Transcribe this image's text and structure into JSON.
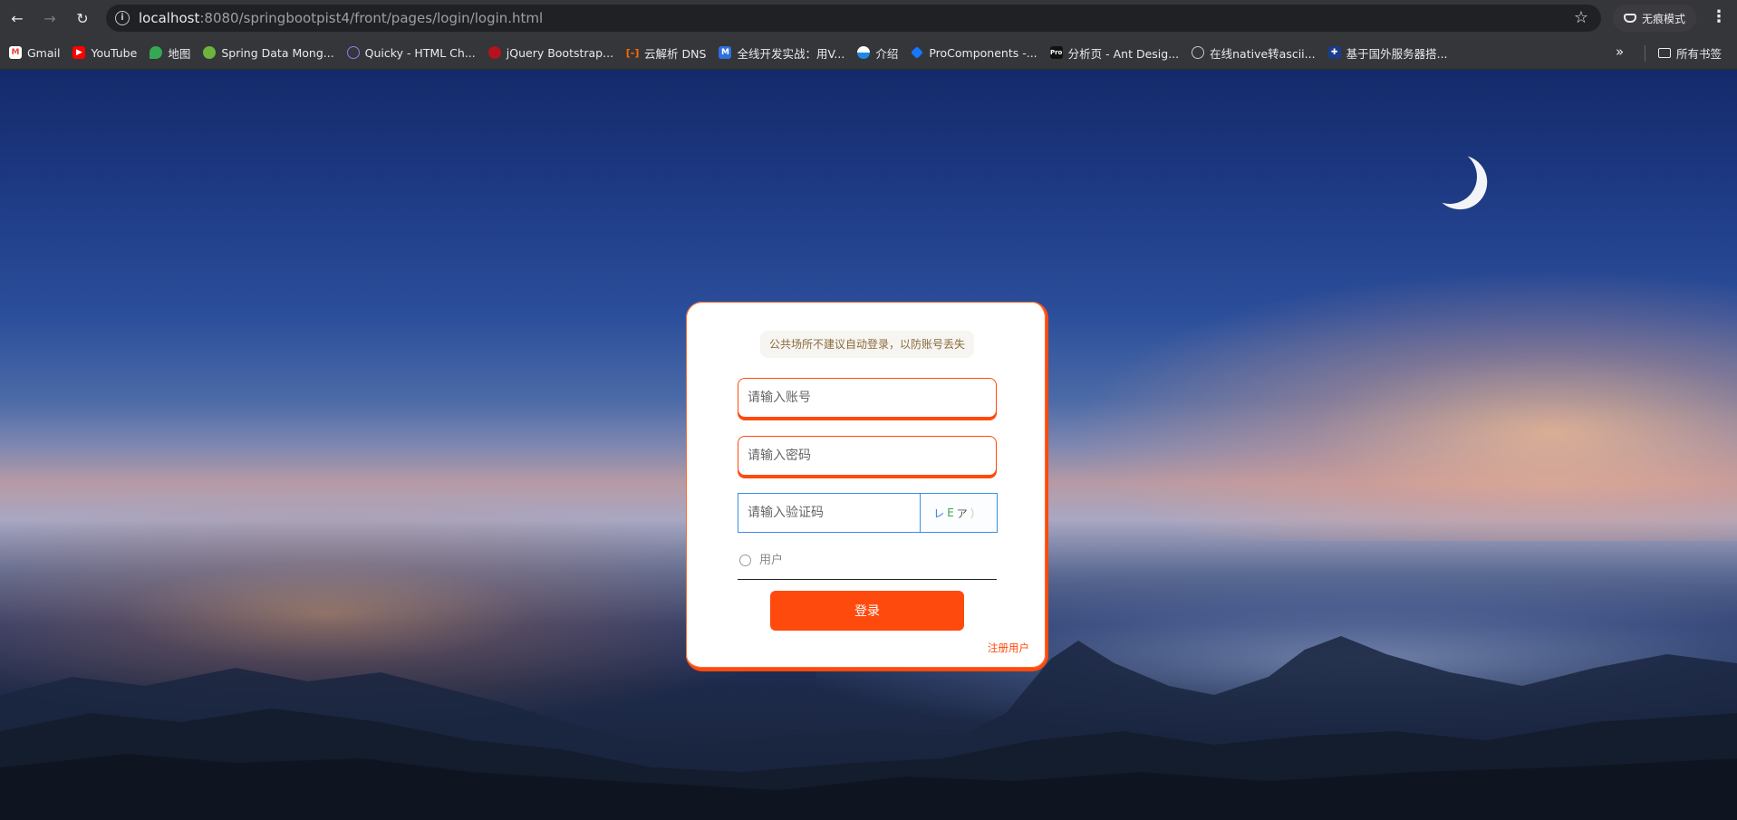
{
  "browser": {
    "url_host": "localhost",
    "url_path": ":8080/springbootpist4/front/pages/login/login.html",
    "incognito_label": "无痕模式",
    "nav_back_icon": "arrow-left-icon",
    "nav_forward_icon": "arrow-right-icon",
    "reload_icon": "reload-icon",
    "bookmark_star_icon": "star-icon",
    "menu_icon": "kebab-menu-icon"
  },
  "bookmarks": {
    "items": [
      {
        "label": "Gmail",
        "icon": "gmail-icon",
        "color": "#ea4335"
      },
      {
        "label": "YouTube",
        "icon": "youtube-icon",
        "color": "#ff0000"
      },
      {
        "label": "地图",
        "icon": "maps-icon",
        "color": "#34a853"
      },
      {
        "label": "Spring Data Mong...",
        "icon": "spring-icon",
        "color": "#6db33f"
      },
      {
        "label": "Quicky - HTML Ch...",
        "icon": "quicky-icon",
        "color": "#6b5bd6"
      },
      {
        "label": "jQuery Bootstrap...",
        "icon": "jquery-icon",
        "color": "#b5121b"
      },
      {
        "label": "云解析 DNS",
        "icon": "aliyun-icon",
        "color": "#ff6a00"
      },
      {
        "label": "全线开发实战：用V...",
        "icon": "m-icon",
        "color": "#2f6fde"
      },
      {
        "label": "介绍",
        "icon": "globe-half-icon",
        "color": "#1e88e5"
      },
      {
        "label": "ProComponents -...",
        "icon": "procomponents-icon",
        "color": "#1677ff"
      },
      {
        "label": "分析页 - Ant Desig...",
        "icon": "pro-icon",
        "color": "#111111"
      },
      {
        "label": "在线native转ascii...",
        "icon": "globe-icon",
        "color": "#9aa0a6"
      },
      {
        "label": "基于国外服务器搭...",
        "icon": "flag-icon",
        "color": "#1d3b8c"
      }
    ],
    "more_label": "»",
    "all_bookmarks_label": "所有书签"
  },
  "login": {
    "notice": "公共场所不建议自动登录，以防账号丢失",
    "account_placeholder": "请输入账号",
    "password_placeholder": "请输入密码",
    "captcha_placeholder": "请输入验证码",
    "captcha_chars": [
      "レ",
      "E",
      "ア",
      "）"
    ],
    "role_label": "用户",
    "login_button": "登录",
    "register_link": "注册用户",
    "accent_color": "#ff4a0e",
    "captcha_border_color": "#3a8ee6"
  }
}
